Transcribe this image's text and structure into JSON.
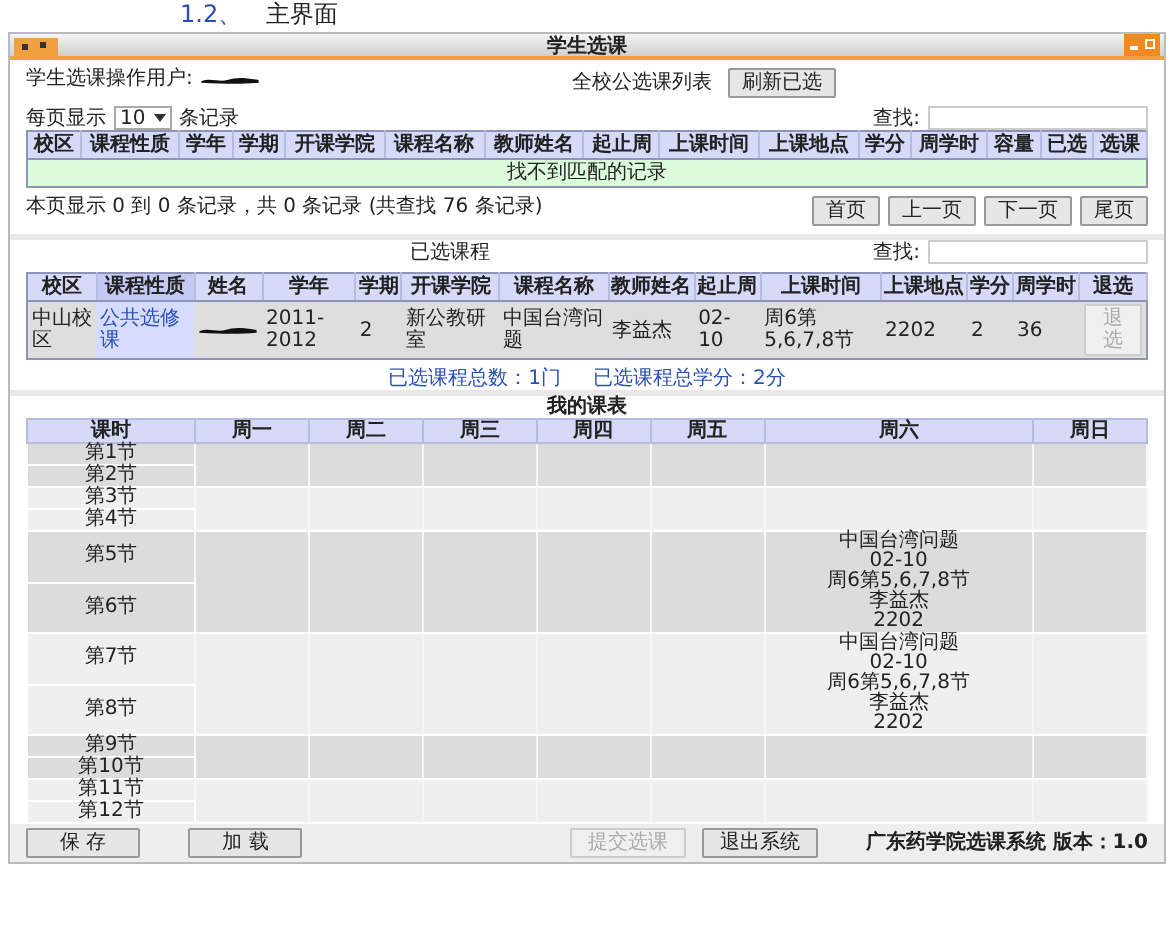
{
  "doc_heading": {
    "number": "1.2、",
    "title": "主界面"
  },
  "window": {
    "title": "学生选课"
  },
  "operator": {
    "label": "学生选课操作用户:"
  },
  "course_list": {
    "title": "全校公选课列表",
    "refresh_button": "刷新已选",
    "page_size": {
      "before": "每页显示",
      "value": "10",
      "after": "条记录"
    },
    "search": {
      "label": "查找:"
    },
    "columns": [
      "校区",
      "课程性质",
      "学年",
      "学期",
      "开课学院",
      "课程名称",
      "教师姓名",
      "起止周",
      "上课时间",
      "上课地点",
      "学分",
      "周学时",
      "容量",
      "已选",
      "选课"
    ],
    "empty_message": "找不到匹配的记录",
    "info": "本页显示 0 到 0 条记录，共 0 条记录 (共查找 76 条记录)",
    "pagination": [
      "首页",
      "上一页",
      "下一页",
      "尾页"
    ]
  },
  "selected_courses": {
    "title": "已选课程",
    "search": {
      "label": "查找:"
    },
    "columns": [
      {
        "label": "校区",
        "sorted": false
      },
      {
        "label": "课程性质",
        "sorted": true
      },
      {
        "label": "姓名",
        "sorted": false
      },
      {
        "label": "学年",
        "sorted": false
      },
      {
        "label": "学期",
        "sorted": false
      },
      {
        "label": "开课学院",
        "sorted": false
      },
      {
        "label": "课程名称",
        "sorted": false
      },
      {
        "label": "教师姓名",
        "sorted": false
      },
      {
        "label": "起止周",
        "sorted": false
      },
      {
        "label": "上课时间",
        "sorted": false
      },
      {
        "label": "上课地点",
        "sorted": false
      },
      {
        "label": "学分",
        "sorted": false
      },
      {
        "label": "周学时",
        "sorted": false
      },
      {
        "label": "退选",
        "sorted": false
      }
    ],
    "rows": [
      {
        "cells": [
          {
            "kind": "text",
            "text": "中山校区"
          },
          {
            "kind": "text",
            "text": "公共选修课"
          },
          {
            "kind": "redacted"
          },
          {
            "kind": "text",
            "text": "2011-2012"
          },
          {
            "kind": "text",
            "text": "2"
          },
          {
            "kind": "text",
            "text": "新公教研室"
          },
          {
            "kind": "text",
            "text": "中国台湾问题"
          },
          {
            "kind": "text",
            "text": "李益杰"
          },
          {
            "kind": "text",
            "text": "02-10"
          },
          {
            "kind": "text",
            "text": "周6第5,6,7,8节"
          },
          {
            "kind": "text",
            "text": "2202"
          },
          {
            "kind": "text",
            "text": "2"
          },
          {
            "kind": "text",
            "text": "36"
          },
          {
            "kind": "button",
            "text": "退选",
            "disabled": true
          }
        ]
      }
    ],
    "summary": [
      "已选课程总数：1门",
      "已选课程总学分：2分"
    ]
  },
  "timetable": {
    "title": "我的课表",
    "columns": [
      "课时",
      "周一",
      "周二",
      "周三",
      "周四",
      "周五",
      "周六",
      "周日"
    ],
    "blocks": [
      {
        "slots": [
          "第1节",
          "第2节"
        ],
        "cells": [
          {},
          {},
          {},
          {},
          {},
          {},
          {}
        ]
      },
      {
        "slots": [
          "第3节",
          "第4节"
        ],
        "cells": [
          {},
          {},
          {},
          {},
          {},
          {},
          {}
        ]
      },
      {
        "slots": [
          "第5节",
          "第6节"
        ],
        "cells": [
          {},
          {},
          {},
          {},
          {},
          {
            "lines": [
              "中国台湾问题",
              "02-10",
              "周6第5,6,7,8节",
              "李益杰",
              "2202"
            ]
          },
          {}
        ]
      },
      {
        "slots": [
          "第7节",
          "第8节"
        ],
        "cells": [
          {},
          {},
          {},
          {},
          {},
          {
            "lines": [
              "中国台湾问题",
              "02-10",
              "周6第5,6,7,8节",
              "李益杰",
              "2202"
            ]
          },
          {}
        ]
      },
      {
        "slots": [
          "第9节",
          "第10节"
        ],
        "cells": [
          {},
          {},
          {},
          {},
          {},
          {},
          {}
        ]
      },
      {
        "slots": [
          "第11节",
          "第12节"
        ],
        "cells": [
          {},
          {},
          {},
          {},
          {},
          {},
          {}
        ]
      }
    ]
  },
  "footer": {
    "left_buttons": [
      {
        "label": "保 存",
        "disabled": false
      },
      {
        "label": "加 载",
        "disabled": false
      }
    ],
    "right_buttons": [
      {
        "label": "提交选课",
        "disabled": true
      },
      {
        "label": "退出系统",
        "disabled": false
      }
    ],
    "version": "广东药学院选课系统 版本：1.0"
  }
}
